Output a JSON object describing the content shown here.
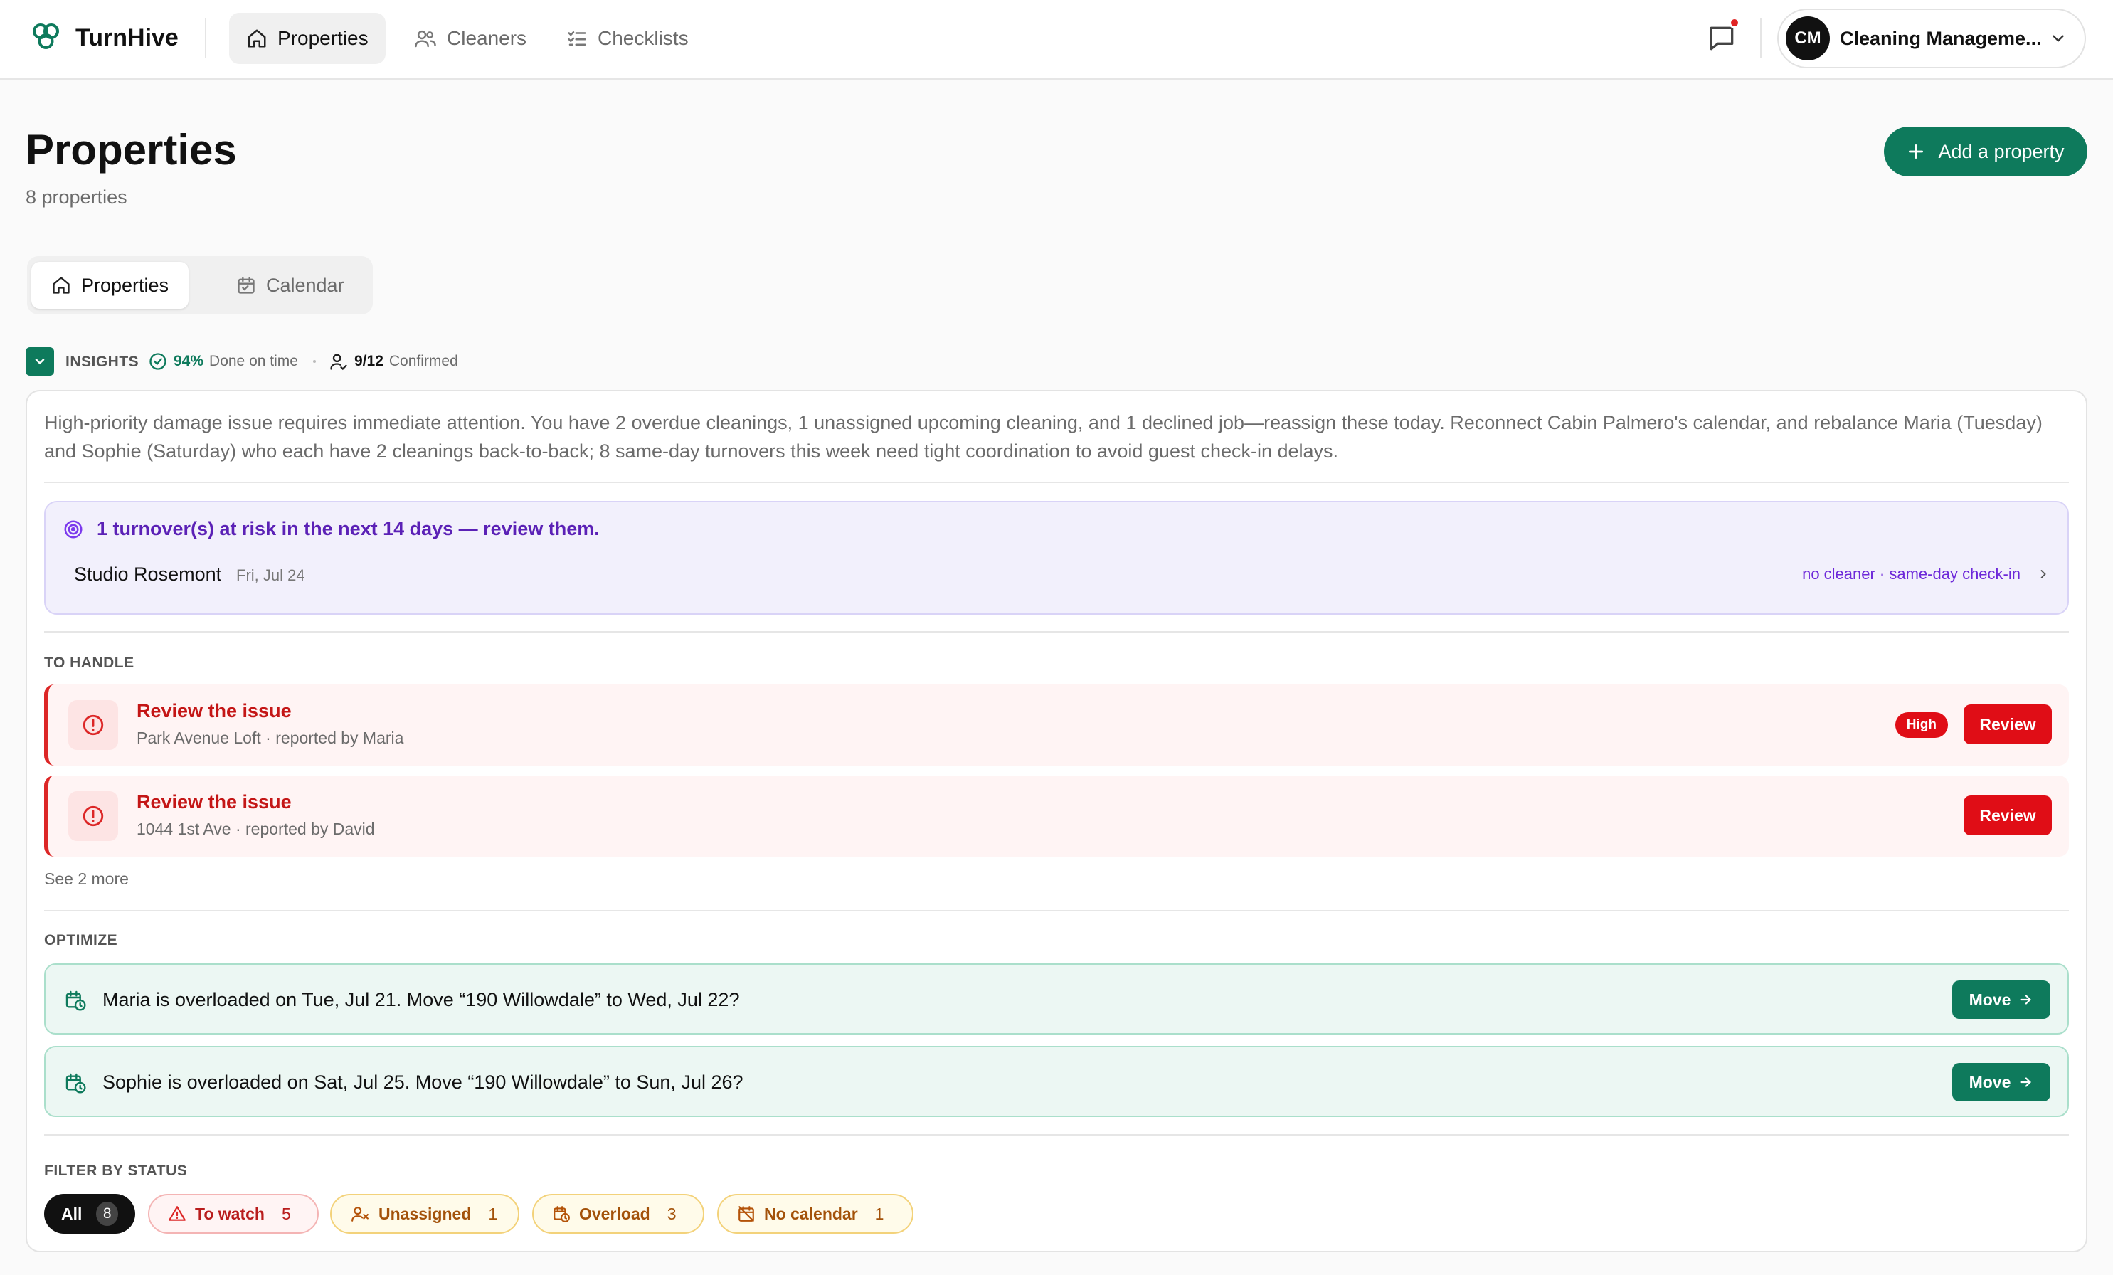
{
  "app": {
    "name": "TurnHive",
    "nav": [
      {
        "label": "Properties"
      },
      {
        "label": "Cleaners"
      },
      {
        "label": "Checklists"
      }
    ],
    "account": {
      "initials": "CM",
      "name": "Cleaning Manageme..."
    }
  },
  "page": {
    "title": "Properties",
    "subtitle": "8 properties",
    "add_button": "Add a property",
    "view_tabs": [
      {
        "label": "Properties"
      },
      {
        "label": "Calendar"
      }
    ]
  },
  "insights": {
    "label": "INSIGHTS",
    "on_time_value": "94%",
    "on_time_label": "Done on time",
    "confirmed_value": "9/12",
    "confirmed_label": "Confirmed",
    "summary": "High-priority damage issue requires immediate attention. You have 2 overdue cleanings, 1 unassigned upcoming cleaning, and 1 declined job—reassign these today. Reconnect Cabin Palmero's calendar, and rebalance Maria (Tuesday) and Sophie (Saturday) who each have 2 cleanings back-to-back; 8 same-day turnovers this week need tight coordination to avoid guest check-in delays.",
    "risk": {
      "headline": "1 turnover(s) at risk in the next 14 days — review them.",
      "property": "Studio Rosemont",
      "date": "Fri, Jul 24",
      "tags": "no cleaner · same-day check-in"
    },
    "to_handle": {
      "label": "TO HANDLE",
      "items": [
        {
          "title": "Review the issue",
          "subtitle": "Park Avenue Loft · reported by Maria",
          "priority": "High",
          "action": "Review"
        },
        {
          "title": "Review the issue",
          "subtitle": "1044 1st Ave · reported by David",
          "action": "Review"
        }
      ],
      "see_more": "See 2 more"
    },
    "optimize": {
      "label": "OPTIMIZE",
      "items": [
        {
          "text": "Maria is overloaded on Tue, Jul 21. Move “190 Willowdale” to Wed, Jul 22?",
          "action": "Move"
        },
        {
          "text": "Sophie is overloaded on Sat, Jul 25. Move “190 Willowdale” to Sun, Jul 26?",
          "action": "Move"
        }
      ]
    },
    "filters": {
      "label": "FILTER BY STATUS",
      "chips": [
        {
          "label": "All",
          "count": "8"
        },
        {
          "label": "To watch",
          "count": "5"
        },
        {
          "label": "Unassigned",
          "count": "1"
        },
        {
          "label": "Overload",
          "count": "3"
        },
        {
          "label": "No calendar",
          "count": "1"
        }
      ]
    }
  },
  "colors": {
    "brand": "#0e7a5c",
    "danger": "#e00d16",
    "risk_text": "#5b21b6",
    "amber": "#a3520a"
  },
  "icons": [
    "turnhive-logo-icon",
    "home-icon",
    "users-icon",
    "checklist-icon",
    "message-icon",
    "chevron-down-icon",
    "plus-icon",
    "calendar-icon",
    "check-circle-icon",
    "user-check-icon",
    "target-icon",
    "chevron-right-icon",
    "alert-circle-icon",
    "calendar-clock-icon",
    "arrow-right-icon",
    "warning-icon",
    "user-x-icon",
    "calendar-off-icon"
  ]
}
